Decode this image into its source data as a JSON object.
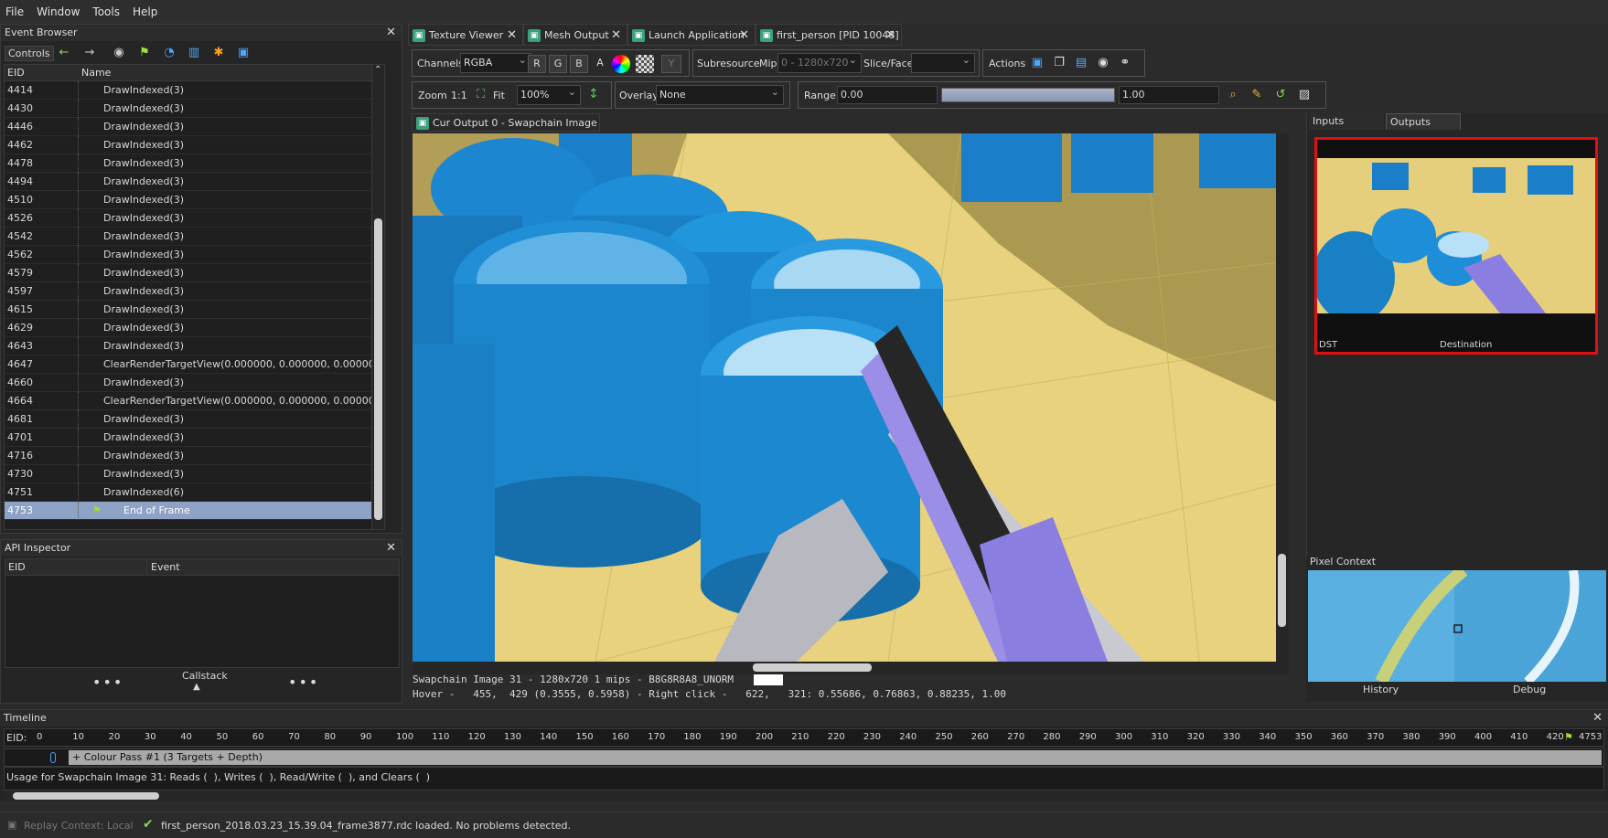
{
  "menu": [
    "File",
    "Window",
    "Tools",
    "Help"
  ],
  "event_browser": {
    "title": "Event Browser",
    "controls_label": "Controls",
    "col_eid": "EID",
    "col_name": "Name",
    "rows": [
      {
        "eid": "4414",
        "name": "DrawIndexed(3)"
      },
      {
        "eid": "4430",
        "name": "DrawIndexed(3)"
      },
      {
        "eid": "4446",
        "name": "DrawIndexed(3)"
      },
      {
        "eid": "4462",
        "name": "DrawIndexed(3)"
      },
      {
        "eid": "4478",
        "name": "DrawIndexed(3)"
      },
      {
        "eid": "4494",
        "name": "DrawIndexed(3)"
      },
      {
        "eid": "4510",
        "name": "DrawIndexed(3)"
      },
      {
        "eid": "4526",
        "name": "DrawIndexed(3)"
      },
      {
        "eid": "4542",
        "name": "DrawIndexed(3)"
      },
      {
        "eid": "4562",
        "name": "DrawIndexed(3)"
      },
      {
        "eid": "4579",
        "name": "DrawIndexed(3)"
      },
      {
        "eid": "4597",
        "name": "DrawIndexed(3)"
      },
      {
        "eid": "4615",
        "name": "DrawIndexed(3)"
      },
      {
        "eid": "4629",
        "name": "DrawIndexed(3)"
      },
      {
        "eid": "4643",
        "name": "DrawIndexed(3)"
      },
      {
        "eid": "4647",
        "name": "ClearRenderTargetView(0.000000, 0.000000, 0.000000, 0.0..."
      },
      {
        "eid": "4660",
        "name": "DrawIndexed(3)"
      },
      {
        "eid": "4664",
        "name": "ClearRenderTargetView(0.000000, 0.000000, 0.000000, 0.0..."
      },
      {
        "eid": "4681",
        "name": "DrawIndexed(3)"
      },
      {
        "eid": "4701",
        "name": "DrawIndexed(3)"
      },
      {
        "eid": "4716",
        "name": "DrawIndexed(3)"
      },
      {
        "eid": "4730",
        "name": "DrawIndexed(3)"
      },
      {
        "eid": "4751",
        "name": "DrawIndexed(6)"
      },
      {
        "eid": "4753",
        "name": "End of Frame",
        "selected": true
      }
    ]
  },
  "api_inspector": {
    "title": "API Inspector",
    "col_eid": "EID",
    "col_event": "Event",
    "callstack": "Callstack"
  },
  "tabs": [
    {
      "label": "Texture Viewer"
    },
    {
      "label": "Mesh Output"
    },
    {
      "label": "Launch Application"
    },
    {
      "label": "first_person [PID 10048]"
    }
  ],
  "toolbar": {
    "channels_label": "Channels",
    "channels_value": "RGBA",
    "r": "R",
    "g": "G",
    "b": "B",
    "a": "A",
    "y": "Y",
    "subresource_label": "Subresource",
    "mip_label": "Mip",
    "mip_value": "0 - 1280x720",
    "slice_label": "Slice/Face",
    "actions_label": "Actions",
    "zoom_label": "Zoom",
    "zoom_11": "1:1",
    "fit_label": "Fit",
    "zoom_value": "100%",
    "overlay_label": "Overlay",
    "overlay_value": "None",
    "range_label": "Range",
    "range_min": "0.00",
    "range_max": "1.00"
  },
  "viewer": {
    "tab_label": "Cur Output 0 - Swapchain Image 31",
    "status1": "Swapchain Image 31 - 1280x720 1 mips - B8G8R8A8_UNORM",
    "status2": "Hover -   455,  429 (0.3555, 0.5958) - Right click -   622,   321: 0.55686, 0.76863, 0.88235, 1.00"
  },
  "right_panel": {
    "tab_inputs": "Inputs",
    "tab_outputs": "Outputs",
    "thumb_left": "DST",
    "thumb_caption": "Destination",
    "pixel_context": "Pixel Context",
    "history": "History",
    "debug": "Debug"
  },
  "timeline": {
    "title": "Timeline",
    "eid_label": "EID:",
    "ticks": [
      "0",
      "10",
      "20",
      "30",
      "40",
      "50",
      "60",
      "70",
      "80",
      "90",
      "100",
      "110",
      "120",
      "130",
      "140",
      "150",
      "160",
      "170",
      "180",
      "190",
      "200",
      "210",
      "220",
      "230",
      "240",
      "250",
      "260",
      "270",
      "280",
      "290",
      "300",
      "310",
      "320",
      "330",
      "340",
      "350",
      "360",
      "370",
      "380",
      "390",
      "400",
      "410",
      "420"
    ],
    "end_eid": "4753",
    "pass_label": "+ Colour Pass #1 (3 Targets + Depth)",
    "usage": "Usage for Swapchain Image 31: Reads (  ), Writes (  ), Read/Write (  ), and Clears (  )"
  },
  "statusbar": {
    "replay": "Replay Context: Local",
    "message": "first_person_2018.03.23_15.39.04_frame3877.rdc loaded. No problems detected."
  },
  "colors": {
    "accent": "#3aa17e",
    "selected_row": "#8ea2c6",
    "highlight_border": "#e01010",
    "scene_blue": "#1f8fd8",
    "scene_floor": "#e8d07a",
    "gun": "#8a7ee0"
  }
}
